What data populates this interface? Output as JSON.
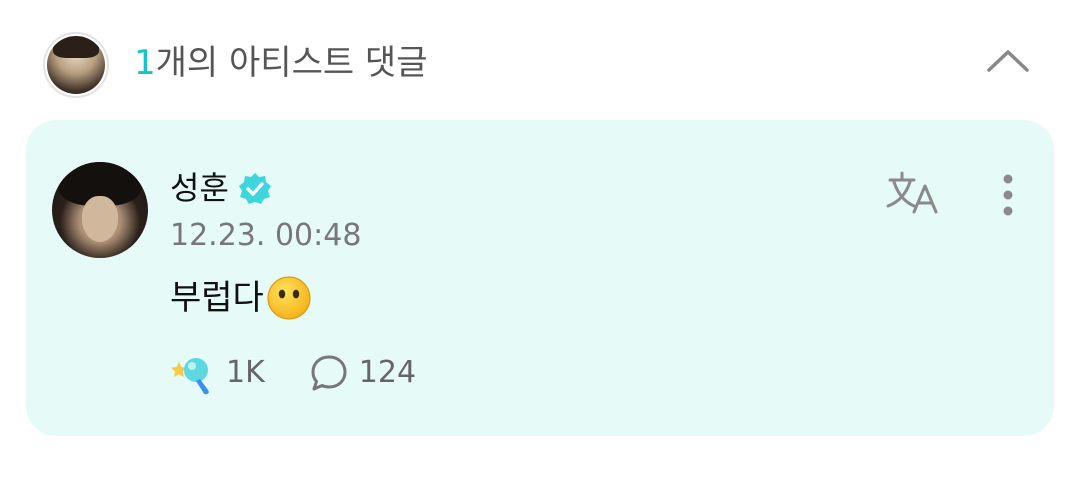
{
  "header": {
    "count": "1",
    "title_suffix": "개의 아티스트 댓글",
    "collapse_icon": "chevron-up-icon"
  },
  "comment": {
    "author_name": "성훈",
    "verified_icon": "verified-badge-icon",
    "timestamp": "12.23. 00:48",
    "text": "부럽다",
    "emoji": "face-without-mouth-emoji",
    "translate_icon": "translate-icon",
    "more_icon": "more-vertical-icon",
    "like_count": "1K",
    "reply_count": "124"
  },
  "colors": {
    "accent": "#16c3c9",
    "card_background": "#e6fbf8",
    "verified": "#3fd5dc"
  }
}
